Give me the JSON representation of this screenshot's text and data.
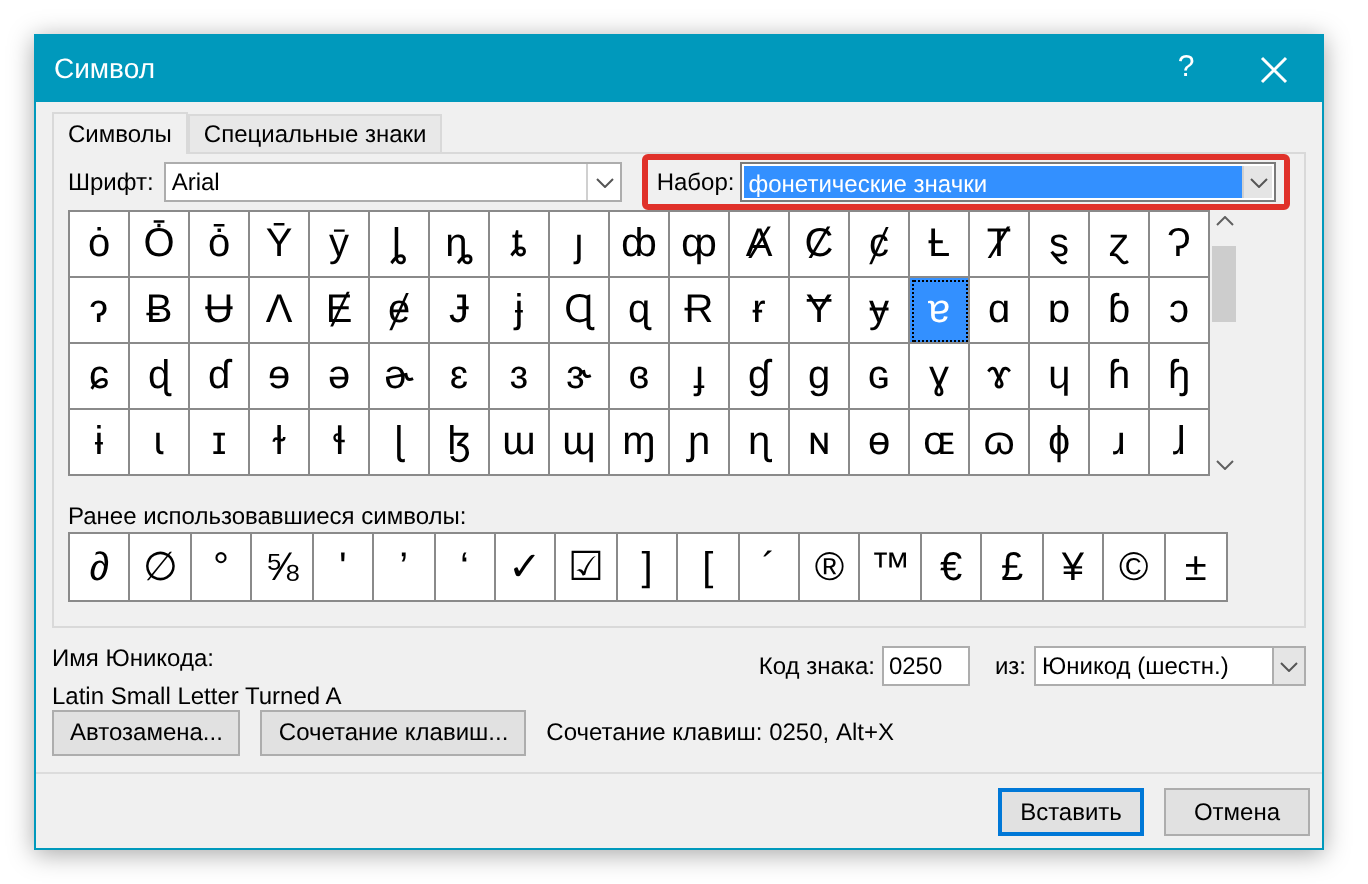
{
  "window": {
    "title": "Символ",
    "help": "?"
  },
  "tabs": [
    {
      "label": "Символы",
      "selected": true
    },
    {
      "label": "Специальные знаки",
      "selected": false
    }
  ],
  "font": {
    "label": "Шрифт:",
    "value": "Arial"
  },
  "subset": {
    "label": "Набор:",
    "value": "фонетические значки"
  },
  "grid": [
    [
      "ȯ",
      "Ȱ",
      "ȱ",
      "Ȳ",
      "ȳ",
      "ȴ",
      "ȵ",
      "ȶ",
      "ȷ",
      "ȸ",
      "ȹ",
      "Ⱥ",
      "Ȼ",
      "ȼ",
      "Ƚ",
      "Ⱦ",
      "ȿ",
      "ɀ",
      "Ɂ"
    ],
    [
      "ɂ",
      "Ƀ",
      "Ʉ",
      "Ʌ",
      "Ɇ",
      "ɇ",
      "Ɉ",
      "ɉ",
      "Ɋ",
      "ɋ",
      "Ɍ",
      "ɍ",
      "Ɏ",
      "ɏ",
      "ɐ",
      "ɑ",
      "ɒ",
      "ɓ",
      "ɔ"
    ],
    [
      "ɕ",
      "ɖ",
      "ɗ",
      "ɘ",
      "ə",
      "ɚ",
      "ɛ",
      "ɜ",
      "ɝ",
      "ɞ",
      "ɟ",
      "ɠ",
      "ɡ",
      "ɢ",
      "ɣ",
      "ɤ",
      "ɥ",
      "ɦ",
      "ɧ"
    ],
    [
      "ɨ",
      "ɩ",
      "ɪ",
      "ɫ",
      "ɬ",
      "ɭ",
      "ɮ",
      "ɯ",
      "ɰ",
      "ɱ",
      "ɲ",
      "ɳ",
      "ɴ",
      "ɵ",
      "ɶ",
      "ɷ",
      "ɸ",
      "ɹ",
      "ɺ"
    ]
  ],
  "selected": [
    [
      false,
      false,
      false,
      false,
      false,
      false,
      false,
      false,
      false,
      false,
      false,
      false,
      false,
      false,
      false,
      false,
      false,
      false,
      false
    ],
    [
      false,
      false,
      false,
      false,
      false,
      false,
      false,
      false,
      false,
      false,
      false,
      false,
      false,
      false,
      true,
      false,
      false,
      false,
      false
    ],
    [
      false,
      false,
      false,
      false,
      false,
      false,
      false,
      false,
      false,
      false,
      false,
      false,
      false,
      false,
      false,
      false,
      false,
      false,
      false
    ],
    [
      false,
      false,
      false,
      false,
      false,
      false,
      false,
      false,
      false,
      false,
      false,
      false,
      false,
      false,
      false,
      false,
      false,
      false,
      false
    ]
  ],
  "recent": {
    "label": "Ранее использовавшиеся символы:",
    "symbols": [
      "∂",
      "∅",
      "°",
      "⅝",
      "'",
      "’",
      "‘",
      "✓",
      "☑",
      "]",
      "[",
      "´",
      "®",
      "™",
      "€",
      "£",
      "¥",
      "©",
      "±"
    ]
  },
  "unicode_name": {
    "label": "Имя Юникода:",
    "value": "Latin Small Letter Turned A"
  },
  "code": {
    "label": "Код знака:",
    "value": "0250"
  },
  "from": {
    "label": "из:",
    "value": "Юникод (шестн.)"
  },
  "buttons": [
    "Автозамена...",
    "Сочетание клавиш..."
  ],
  "shortcut": "Сочетание клавиш: 0250, Alt+X",
  "footer_buttons": [
    {
      "label": "Вставить",
      "default": true
    },
    {
      "label": "Отмена",
      "default": false
    }
  ]
}
